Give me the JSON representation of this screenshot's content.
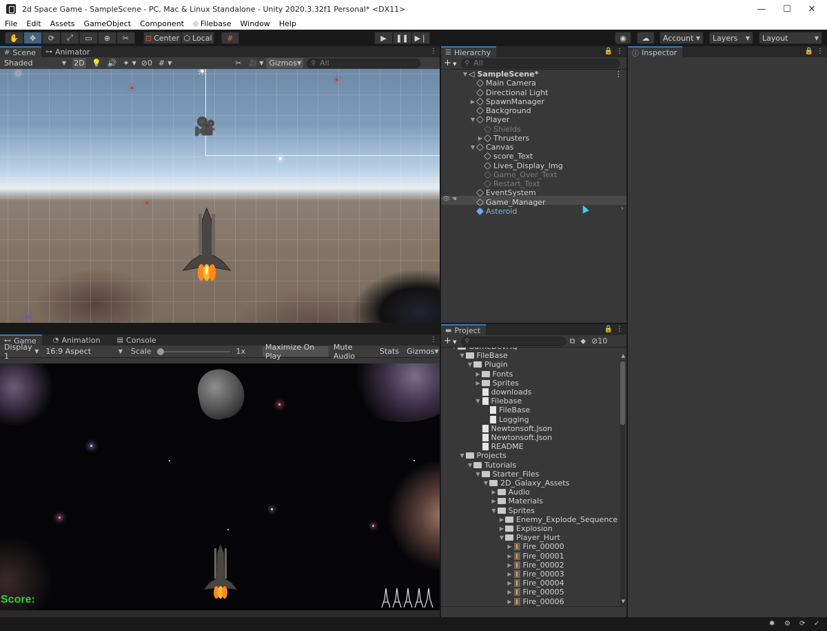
{
  "window": {
    "title": "2d Space Game - SampleScene - PC, Mac & Linux Standalone - Unity 2020.3.32f1 Personal* <DX11>",
    "controls": [
      "—",
      "☐",
      "✕"
    ]
  },
  "menu": [
    "File",
    "Edit",
    "Assets",
    "GameObject",
    "Component",
    "Filebase",
    "Window",
    "Help"
  ],
  "toolbar": {
    "pivot": "Center",
    "space": "Local",
    "account": "Account",
    "layers": "Layers",
    "layout": "Layout"
  },
  "scene_panel": {
    "tabs": [
      "Scene",
      "Animator"
    ],
    "shading": "Shaded",
    "mode_2d": "2D",
    "hidden_count": "0",
    "gizmos": "Gizmos",
    "search_placeholder": "All"
  },
  "game_panel": {
    "tabs": [
      "Game",
      "Animation",
      "Console"
    ],
    "display": "Display 1",
    "aspect": "16:9 Aspect",
    "scale_label": "Scale",
    "scale_value": "1x",
    "maximize": "Maximize On Play",
    "mute": "Mute Audio",
    "stats": "Stats",
    "gizmos": "Gizmos",
    "score_label": "Score:"
  },
  "hierarchy": {
    "tab": "Hierarchy",
    "search_placeholder": "All",
    "items": [
      {
        "label": "SampleScene*",
        "depth": 0,
        "type": "scene",
        "arrow": "▼"
      },
      {
        "label": "Main Camera",
        "depth": 1,
        "type": "go",
        "arrow": ""
      },
      {
        "label": "Directional Light",
        "depth": 1,
        "type": "go",
        "arrow": ""
      },
      {
        "label": "SpawnManager",
        "depth": 1,
        "type": "go",
        "arrow": "▶"
      },
      {
        "label": "Background",
        "depth": 1,
        "type": "go",
        "arrow": ""
      },
      {
        "label": "Player",
        "depth": 1,
        "type": "go",
        "arrow": "▼"
      },
      {
        "label": "Shields",
        "depth": 2,
        "type": "dim",
        "arrow": ""
      },
      {
        "label": "Thrusters",
        "depth": 2,
        "type": "go",
        "arrow": "▶"
      },
      {
        "label": "Canvas",
        "depth": 1,
        "type": "go",
        "arrow": "▼"
      },
      {
        "label": "score_Text",
        "depth": 2,
        "type": "go",
        "arrow": ""
      },
      {
        "label": "Lives_Display_Img",
        "depth": 2,
        "type": "go",
        "arrow": ""
      },
      {
        "label": "Game_Over_Text",
        "depth": 2,
        "type": "dim",
        "arrow": ""
      },
      {
        "label": "Restart_Text",
        "depth": 2,
        "type": "dim",
        "arrow": ""
      },
      {
        "label": "EventSystem",
        "depth": 1,
        "type": "go",
        "arrow": ""
      },
      {
        "label": "Game_Manager",
        "depth": 1,
        "type": "go",
        "arrow": ""
      },
      {
        "label": "Asteroid",
        "depth": 1,
        "type": "prefab",
        "arrow": ""
      }
    ]
  },
  "inspector": {
    "tab": "Inspector"
  },
  "project": {
    "tab": "Project",
    "hidden_count": "10",
    "items": [
      {
        "label": "GameDevHQ",
        "depth": 0,
        "type": "folder",
        "arrow": "▼"
      },
      {
        "label": "FileBase",
        "depth": 1,
        "type": "folder",
        "arrow": "▼"
      },
      {
        "label": "Plugin",
        "depth": 2,
        "type": "folder",
        "arrow": "▼"
      },
      {
        "label": "Fonts",
        "depth": 3,
        "type": "folder",
        "arrow": "▶"
      },
      {
        "label": "Sprites",
        "depth": 3,
        "type": "folder",
        "arrow": "▶"
      },
      {
        "label": "downloads",
        "depth": 3,
        "type": "doc",
        "arrow": ""
      },
      {
        "label": "Filebase",
        "depth": 3,
        "type": "doc",
        "arrow": "▼"
      },
      {
        "label": "FileBase",
        "depth": 4,
        "type": "doc",
        "arrow": ""
      },
      {
        "label": "Logging",
        "depth": 4,
        "type": "doc",
        "arrow": ""
      },
      {
        "label": "Newtonsoft.Json",
        "depth": 3,
        "type": "doc",
        "arrow": ""
      },
      {
        "label": "Newtonsoft.Json",
        "depth": 3,
        "type": "doc",
        "arrow": ""
      },
      {
        "label": "README",
        "depth": 3,
        "type": "doc",
        "arrow": ""
      },
      {
        "label": "Projects",
        "depth": 1,
        "type": "folder",
        "arrow": "▼"
      },
      {
        "label": "Tutorials",
        "depth": 2,
        "type": "folder",
        "arrow": "▼"
      },
      {
        "label": "Starter_Files",
        "depth": 3,
        "type": "folder",
        "arrow": "▼"
      },
      {
        "label": "2D_Galaxy_Assets",
        "depth": 4,
        "type": "folder",
        "arrow": "▼"
      },
      {
        "label": "Audio",
        "depth": 5,
        "type": "folder",
        "arrow": "▶"
      },
      {
        "label": "Materials",
        "depth": 5,
        "type": "folder",
        "arrow": "▶"
      },
      {
        "label": "Sprites",
        "depth": 5,
        "type": "folder",
        "arrow": "▼"
      },
      {
        "label": "Enemy_Explode_Sequence",
        "depth": 6,
        "type": "folder",
        "arrow": "▶"
      },
      {
        "label": "Explosion",
        "depth": 6,
        "type": "folder",
        "arrow": "▶"
      },
      {
        "label": "Player_Hurt",
        "depth": 6,
        "type": "folder",
        "arrow": "▼"
      },
      {
        "label": "Fire_00000",
        "depth": 7,
        "type": "fire",
        "arrow": "▶"
      },
      {
        "label": "Fire_00001",
        "depth": 7,
        "type": "fire",
        "arrow": "▶"
      },
      {
        "label": "Fire_00002",
        "depth": 7,
        "type": "fire",
        "arrow": "▶"
      },
      {
        "label": "Fire_00003",
        "depth": 7,
        "type": "fire",
        "arrow": "▶"
      },
      {
        "label": "Fire_00004",
        "depth": 7,
        "type": "fire",
        "arrow": "▶"
      },
      {
        "label": "Fire_00005",
        "depth": 7,
        "type": "fire",
        "arrow": "▶"
      },
      {
        "label": "Fire_00006",
        "depth": 7,
        "type": "fire",
        "arrow": "▶"
      }
    ]
  },
  "colors": {
    "accent_tab": "#3a79bb",
    "score_green": "#2fd12f",
    "prefab_blue": "#7cb3f0"
  }
}
